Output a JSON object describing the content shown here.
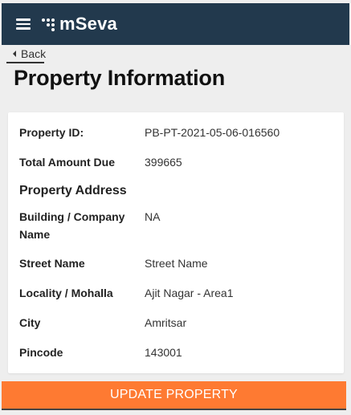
{
  "header": {
    "brand": "mSeva"
  },
  "nav": {
    "back_label": "Back"
  },
  "page": {
    "title": "Property Information"
  },
  "details": {
    "property_id": {
      "label": "Property ID:",
      "value": "PB-PT-2021-05-06-016560"
    },
    "total_amount_due": {
      "label": "Total Amount Due",
      "value": "399665"
    }
  },
  "address": {
    "section_title": "Property Address",
    "building": {
      "label": "Building / Company Name",
      "value": "NA"
    },
    "street": {
      "label": "Street Name",
      "value": "Street Name"
    },
    "locality": {
      "label": "Locality / Mohalla",
      "value": "Ajit Nagar - Area1"
    },
    "city": {
      "label": "City",
      "value": "Amritsar"
    },
    "pincode": {
      "label": "Pincode",
      "value": "143001"
    }
  },
  "actions": {
    "update_label": "UPDATE PROPERTY"
  },
  "colors": {
    "header_bg": "#22394d",
    "accent": "#fe7a32"
  },
  "icons": {
    "menu": "hamburger-menu-icon",
    "back": "caret-left-icon",
    "logo": "mseva-logo-icon"
  }
}
